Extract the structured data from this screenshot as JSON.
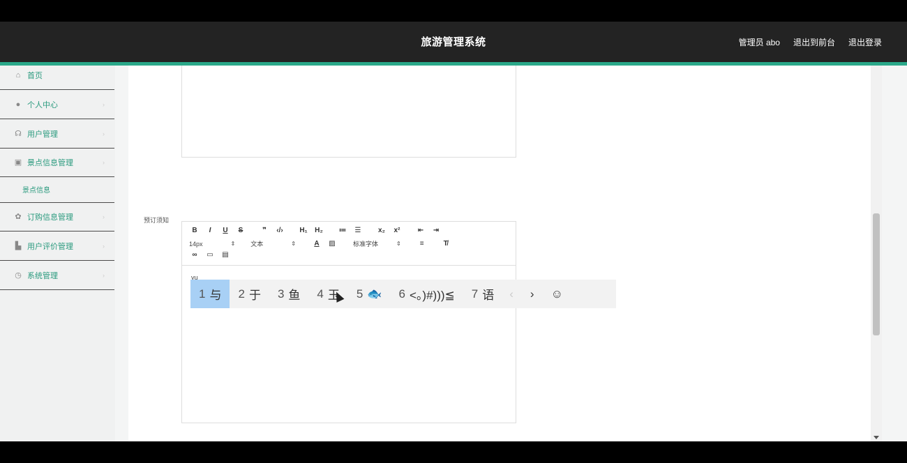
{
  "header": {
    "title": "旅游管理系统",
    "links": [
      "管理员 abo",
      "退出到前台",
      "退出登录"
    ]
  },
  "sidebar": {
    "items": [
      {
        "label": "首页",
        "icon": "home-icon"
      },
      {
        "label": "个人中心",
        "icon": "user-icon"
      },
      {
        "label": "用户管理",
        "icon": "users-icon"
      },
      {
        "label": "景点信息管理",
        "icon": "box-icon",
        "sub": "景点信息"
      },
      {
        "label": "订购信息管理",
        "icon": "gear-icon"
      },
      {
        "label": "用户评价管理",
        "icon": "chart-icon"
      },
      {
        "label": "系统管理",
        "icon": "settings-icon"
      }
    ]
  },
  "form": {
    "field_label": "预订须知",
    "font_size": "14px",
    "text_type": "文本",
    "font_family": "标准字体",
    "typed_text": "yu"
  },
  "ime": {
    "candidates": [
      {
        "n": "1",
        "text": "与"
      },
      {
        "n": "2",
        "text": "于"
      },
      {
        "n": "3",
        "text": "鱼"
      },
      {
        "n": "4",
        "text": "玉"
      },
      {
        "n": "5",
        "text": "🐟"
      },
      {
        "n": "6",
        "text": "<。)#)))≦"
      },
      {
        "n": "7",
        "text": "语"
      }
    ],
    "prev": "‹",
    "next": "›",
    "emoji": "☺"
  },
  "colors": {
    "accent": "#2aa889",
    "topbar": "#232323"
  }
}
